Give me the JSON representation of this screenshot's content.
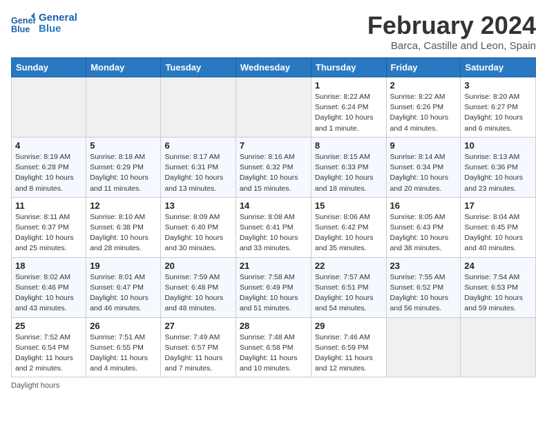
{
  "header": {
    "logo_text_general": "General",
    "logo_text_blue": "Blue",
    "month_title": "February 2024",
    "subtitle": "Barca, Castille and Leon, Spain"
  },
  "columns": [
    "Sunday",
    "Monday",
    "Tuesday",
    "Wednesday",
    "Thursday",
    "Friday",
    "Saturday"
  ],
  "weeks": [
    [
      {
        "day": "",
        "info": ""
      },
      {
        "day": "",
        "info": ""
      },
      {
        "day": "",
        "info": ""
      },
      {
        "day": "",
        "info": ""
      },
      {
        "day": "1",
        "info": "Sunrise: 8:22 AM\nSunset: 6:24 PM\nDaylight: 10 hours and 1 minute."
      },
      {
        "day": "2",
        "info": "Sunrise: 8:22 AM\nSunset: 6:26 PM\nDaylight: 10 hours and 4 minutes."
      },
      {
        "day": "3",
        "info": "Sunrise: 8:20 AM\nSunset: 6:27 PM\nDaylight: 10 hours and 6 minutes."
      }
    ],
    [
      {
        "day": "4",
        "info": "Sunrise: 8:19 AM\nSunset: 6:28 PM\nDaylight: 10 hours and 8 minutes."
      },
      {
        "day": "5",
        "info": "Sunrise: 8:18 AM\nSunset: 6:29 PM\nDaylight: 10 hours and 11 minutes."
      },
      {
        "day": "6",
        "info": "Sunrise: 8:17 AM\nSunset: 6:31 PM\nDaylight: 10 hours and 13 minutes."
      },
      {
        "day": "7",
        "info": "Sunrise: 8:16 AM\nSunset: 6:32 PM\nDaylight: 10 hours and 15 minutes."
      },
      {
        "day": "8",
        "info": "Sunrise: 8:15 AM\nSunset: 6:33 PM\nDaylight: 10 hours and 18 minutes."
      },
      {
        "day": "9",
        "info": "Sunrise: 8:14 AM\nSunset: 6:34 PM\nDaylight: 10 hours and 20 minutes."
      },
      {
        "day": "10",
        "info": "Sunrise: 8:13 AM\nSunset: 6:36 PM\nDaylight: 10 hours and 23 minutes."
      }
    ],
    [
      {
        "day": "11",
        "info": "Sunrise: 8:11 AM\nSunset: 6:37 PM\nDaylight: 10 hours and 25 minutes."
      },
      {
        "day": "12",
        "info": "Sunrise: 8:10 AM\nSunset: 6:38 PM\nDaylight: 10 hours and 28 minutes."
      },
      {
        "day": "13",
        "info": "Sunrise: 8:09 AM\nSunset: 6:40 PM\nDaylight: 10 hours and 30 minutes."
      },
      {
        "day": "14",
        "info": "Sunrise: 8:08 AM\nSunset: 6:41 PM\nDaylight: 10 hours and 33 minutes."
      },
      {
        "day": "15",
        "info": "Sunrise: 8:06 AM\nSunset: 6:42 PM\nDaylight: 10 hours and 35 minutes."
      },
      {
        "day": "16",
        "info": "Sunrise: 8:05 AM\nSunset: 6:43 PM\nDaylight: 10 hours and 38 minutes."
      },
      {
        "day": "17",
        "info": "Sunrise: 8:04 AM\nSunset: 6:45 PM\nDaylight: 10 hours and 40 minutes."
      }
    ],
    [
      {
        "day": "18",
        "info": "Sunrise: 8:02 AM\nSunset: 6:46 PM\nDaylight: 10 hours and 43 minutes."
      },
      {
        "day": "19",
        "info": "Sunrise: 8:01 AM\nSunset: 6:47 PM\nDaylight: 10 hours and 46 minutes."
      },
      {
        "day": "20",
        "info": "Sunrise: 7:59 AM\nSunset: 6:48 PM\nDaylight: 10 hours and 48 minutes."
      },
      {
        "day": "21",
        "info": "Sunrise: 7:58 AM\nSunset: 6:49 PM\nDaylight: 10 hours and 51 minutes."
      },
      {
        "day": "22",
        "info": "Sunrise: 7:57 AM\nSunset: 6:51 PM\nDaylight: 10 hours and 54 minutes."
      },
      {
        "day": "23",
        "info": "Sunrise: 7:55 AM\nSunset: 6:52 PM\nDaylight: 10 hours and 56 minutes."
      },
      {
        "day": "24",
        "info": "Sunrise: 7:54 AM\nSunset: 6:53 PM\nDaylight: 10 hours and 59 minutes."
      }
    ],
    [
      {
        "day": "25",
        "info": "Sunrise: 7:52 AM\nSunset: 6:54 PM\nDaylight: 11 hours and 2 minutes."
      },
      {
        "day": "26",
        "info": "Sunrise: 7:51 AM\nSunset: 6:55 PM\nDaylight: 11 hours and 4 minutes."
      },
      {
        "day": "27",
        "info": "Sunrise: 7:49 AM\nSunset: 6:57 PM\nDaylight: 11 hours and 7 minutes."
      },
      {
        "day": "28",
        "info": "Sunrise: 7:48 AM\nSunset: 6:58 PM\nDaylight: 11 hours and 10 minutes."
      },
      {
        "day": "29",
        "info": "Sunrise: 7:46 AM\nSunset: 6:59 PM\nDaylight: 11 hours and 12 minutes."
      },
      {
        "day": "",
        "info": ""
      },
      {
        "day": "",
        "info": ""
      }
    ]
  ],
  "footer": {
    "daylight_hours_label": "Daylight hours"
  }
}
